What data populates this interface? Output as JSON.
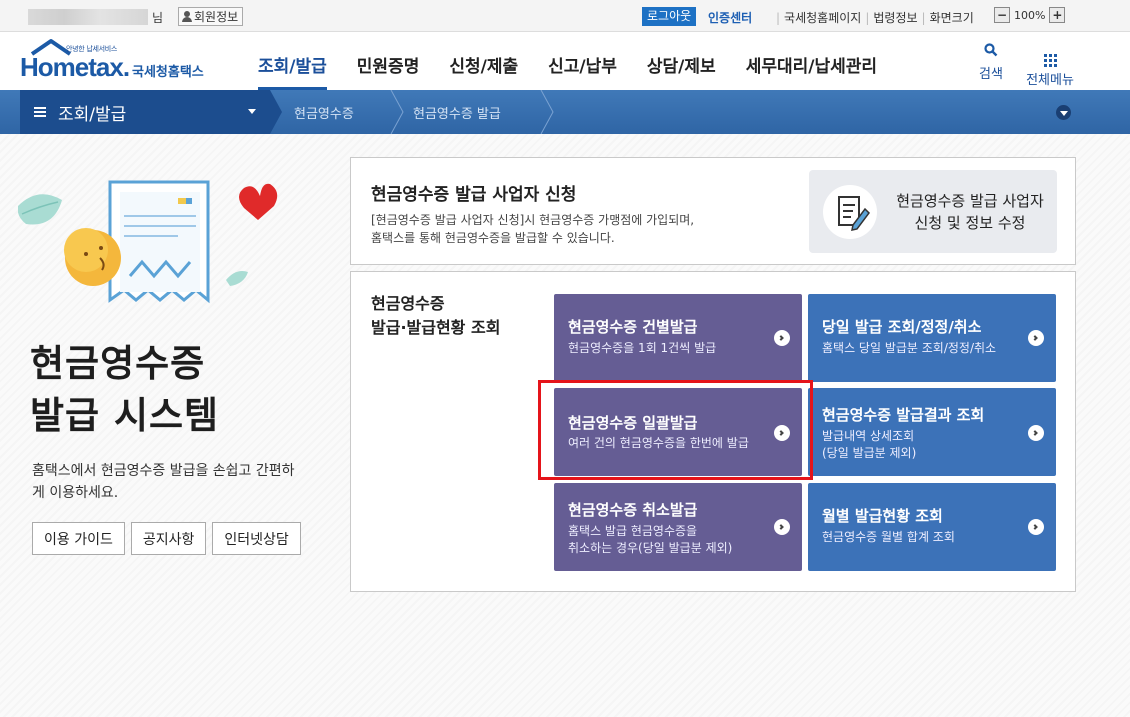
{
  "topbar": {
    "suffix": "님",
    "member_info": "회원정보",
    "logout": "로그아웃",
    "cert_center": "인증센터",
    "links": [
      "국세청홈페이지",
      "법령정보",
      "화면크기"
    ],
    "zoom_minus": "−",
    "zoom_level": "100%",
    "zoom_plus": "+"
  },
  "header": {
    "logo_tagline": "안녕한 납세서비스",
    "logo_wordmark": "Hometax.",
    "logo_org": "국세청홈택스",
    "gnb": [
      "조회/발급",
      "민원증명",
      "신청/제출",
      "신고/납부",
      "상담/제보",
      "세무대리/납세관리"
    ],
    "active_gnb": "조회/발급",
    "search_label": "검색",
    "menu_label": "전체메뉴"
  },
  "navbar": {
    "section": "조회/발급",
    "crumbs": [
      "현금영수증",
      "현금영수증 발급"
    ]
  },
  "hero": {
    "title_line1": "현금영수증",
    "title_line2": "발급 시스템",
    "desc": "홈택스에서 현금영수증 발급을 손쉽고 간편하게 이용하세요.",
    "buttons": [
      "이용 가이드",
      "공지사항",
      "인터넷상담"
    ]
  },
  "register_panel": {
    "title": "현금영수증 발급 사업자 신청",
    "desc_line1": "[현금영수증 발급 사업자 신청]시 현금영수증 가맹점에 가입되며,",
    "desc_line2": "홈택스를 통해 현금영수증을 발급할 수 있습니다.",
    "button_line1": "현금영수증 발급 사업자",
    "button_line2": "신청 및 정보 수정"
  },
  "issue_panel": {
    "title_line1": "현금영수증",
    "title_line2": "발급·발급현황 조회",
    "tiles": [
      {
        "title": "현금영수증 건별발급",
        "sub": [
          "현금영수증을 1회 1건씩 발급"
        ],
        "color": "#655d94"
      },
      {
        "title": "당일 발급 조회/정정/취소",
        "sub": [
          "홈택스 당일 발급분 조회/정정/취소"
        ],
        "color": "#3c72b8"
      },
      {
        "title": "현금영수증 일괄발급",
        "sub": [
          "여러 건의 현금영수증을 한번에 발급"
        ],
        "color": "#655d94"
      },
      {
        "title": "현금영수증 발급결과 조회",
        "sub": [
          "발급내역 상세조회",
          "(당일 발급분 제외)"
        ],
        "color": "#3c72b8"
      },
      {
        "title": "현금영수증 취소발급",
        "sub": [
          "홈택스 발급 현금영수증을",
          "취소하는 경우(당일 발급분 제외)"
        ],
        "color": "#655d94"
      },
      {
        "title": "월별 발급현황 조회",
        "sub": [
          "현금영수증 월별 합계 조회"
        ],
        "color": "#3c72b8"
      }
    ],
    "highlight_color": "#e5141a"
  }
}
